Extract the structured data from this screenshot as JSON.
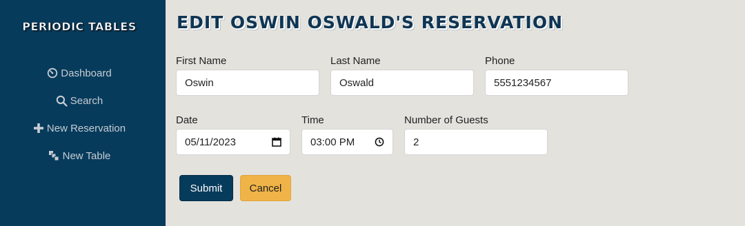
{
  "sidebar": {
    "brand": "PERIODIC TABLES",
    "items": [
      {
        "label": "Dashboard",
        "icon": "dashboard-icon"
      },
      {
        "label": "Search",
        "icon": "search-icon"
      },
      {
        "label": "New Reservation",
        "icon": "plus-icon"
      },
      {
        "label": "New Table",
        "icon": "layers-icon"
      }
    ]
  },
  "page": {
    "title": "EDIT OSWIN OSWALD'S RESERVATION"
  },
  "form": {
    "first_name": {
      "label": "First Name",
      "value": "Oswin"
    },
    "last_name": {
      "label": "Last Name",
      "value": "Oswald"
    },
    "phone": {
      "label": "Phone",
      "value": "5551234567"
    },
    "date": {
      "label": "Date",
      "value": "05/11/2023",
      "icon": "calendar-icon"
    },
    "time": {
      "label": "Time",
      "value": "03:00 PM",
      "icon": "clock-icon"
    },
    "guests": {
      "label": "Number of Guests",
      "value": "2"
    }
  },
  "buttons": {
    "submit": "Submit",
    "cancel": "Cancel"
  },
  "colors": {
    "sidebar": "#073b5c",
    "accent": "#f0b348",
    "background": "#e4e2dd"
  }
}
